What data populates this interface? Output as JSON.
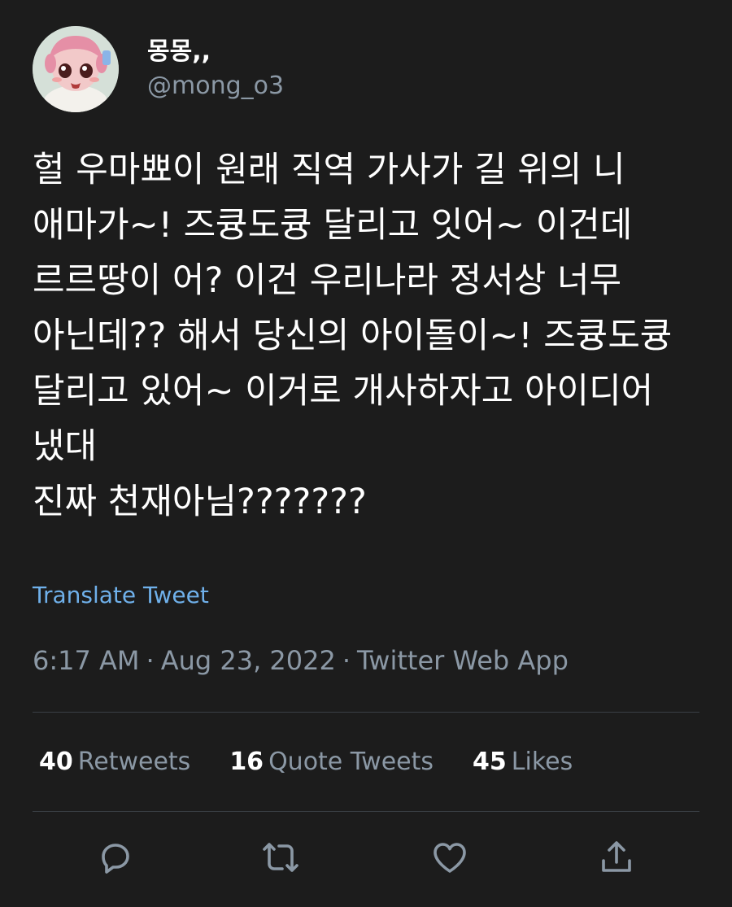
{
  "user": {
    "display_name": "몽몽,,",
    "handle": "@mong_o3",
    "avatar_icon": "avatar-character-icon"
  },
  "tweet": {
    "text": "헐 우마뾰이 원래 직역 가사가 길 위의 니 애마가~! 즈큥도큥 달리고 잇어~ 이건데\n르르땅이 어? 이건 우리나라 정서상 너무 아닌데?? 해서 당신의 아이돌이~! 즈큥도큥 달리고 있어~ 이거로 개사하자고 아이디어 냈대\n진짜 천재아님???????",
    "translate_label": "Translate Tweet",
    "time": "6:17 AM",
    "date": "Aug 23, 2022",
    "source": "Twitter Web App",
    "separator": "·"
  },
  "stats": {
    "retweets_count": "40",
    "retweets_label": "Retweets",
    "quotes_count": "16",
    "quotes_label": "Quote Tweets",
    "likes_count": "45",
    "likes_label": "Likes"
  },
  "actions": [
    "reply-icon",
    "retweet-icon",
    "like-icon",
    "share-icon"
  ],
  "colors": {
    "background": "#1c1c1c",
    "text": "#ffffff",
    "secondary": "#8b98a5",
    "link": "#6fb0ea",
    "divider": "#3a3f45"
  }
}
